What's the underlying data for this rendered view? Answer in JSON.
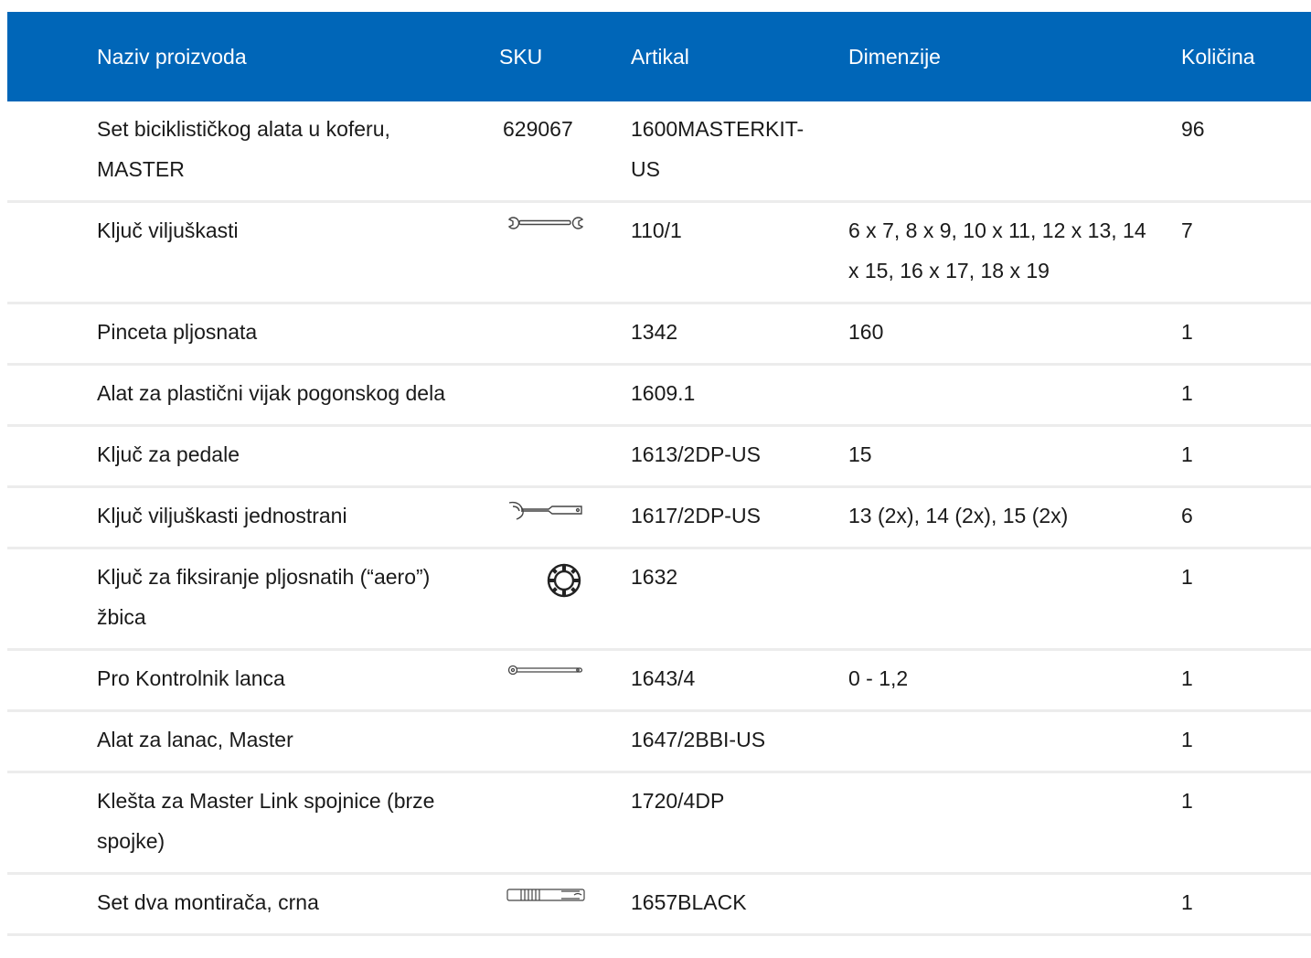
{
  "table": {
    "headers": {
      "name": "Naziv proizvoda",
      "sku": "SKU",
      "article": "Artikal",
      "dimensions": "Dimenzije",
      "quantity": "Količina"
    },
    "rows": [
      {
        "name": "Set biciklističkog alata u koferu, MASTER",
        "sku": "629067",
        "icon": "",
        "article": "1600MASTERKIT-US",
        "dimensions": "",
        "quantity": "96"
      },
      {
        "name": "Ključ viljuškasti",
        "sku": "",
        "icon": "open-end-wrench-icon",
        "article": "110/1",
        "dimensions": "6 x 7, 8 x 9, 10 x 11, 12 x 13, 14 x 15, 16 x 17, 18 x 19",
        "quantity": "7"
      },
      {
        "name": "Pinceta pljosnata",
        "sku": "",
        "icon": "",
        "article": "1342",
        "dimensions": "160",
        "quantity": "1"
      },
      {
        "name": "Alat za plastični vijak pogonskog dela",
        "sku": "",
        "icon": "",
        "article": "1609.1",
        "dimensions": "",
        "quantity": "1"
      },
      {
        "name": "Ključ za pedale",
        "sku": "",
        "icon": "",
        "article": "1613/2DP-US",
        "dimensions": "15",
        "quantity": "1"
      },
      {
        "name": "Ključ viljuškasti jednostrani",
        "sku": "",
        "icon": "single-open-end-wrench-icon",
        "article": "1617/2DP-US",
        "dimensions": "13 (2x), 14 (2x), 15 (2x)",
        "quantity": "6"
      },
      {
        "name": "Ključ za fiksiranje pljosnatih (“aero”) žbica",
        "sku": "",
        "icon": "spoke-key-icon",
        "article": "1632",
        "dimensions": "",
        "quantity": "1"
      },
      {
        "name": "Pro Kontrolnik lanca",
        "sku": "",
        "icon": "chain-checker-icon",
        "article": "1643/4",
        "dimensions": "0 - 1,2",
        "quantity": "1"
      },
      {
        "name": "Alat za lanac, Master",
        "sku": "",
        "icon": "",
        "article": "1647/2BBI-US",
        "dimensions": "",
        "quantity": "1"
      },
      {
        "name": "Klešta za Master Link spojnice (brze spojke)",
        "sku": "",
        "icon": "",
        "article": "1720/4DP",
        "dimensions": "",
        "quantity": "1"
      },
      {
        "name": "Set dva montirača, crna",
        "sku": "",
        "icon": "tire-lever-icon",
        "article": "1657BLACK",
        "dimensions": "",
        "quantity": "1"
      }
    ]
  },
  "colors": {
    "header_bg": "#0066b8",
    "header_text": "#ffffff",
    "row_divider": "#ececec",
    "body_text": "#1a1a1a"
  }
}
